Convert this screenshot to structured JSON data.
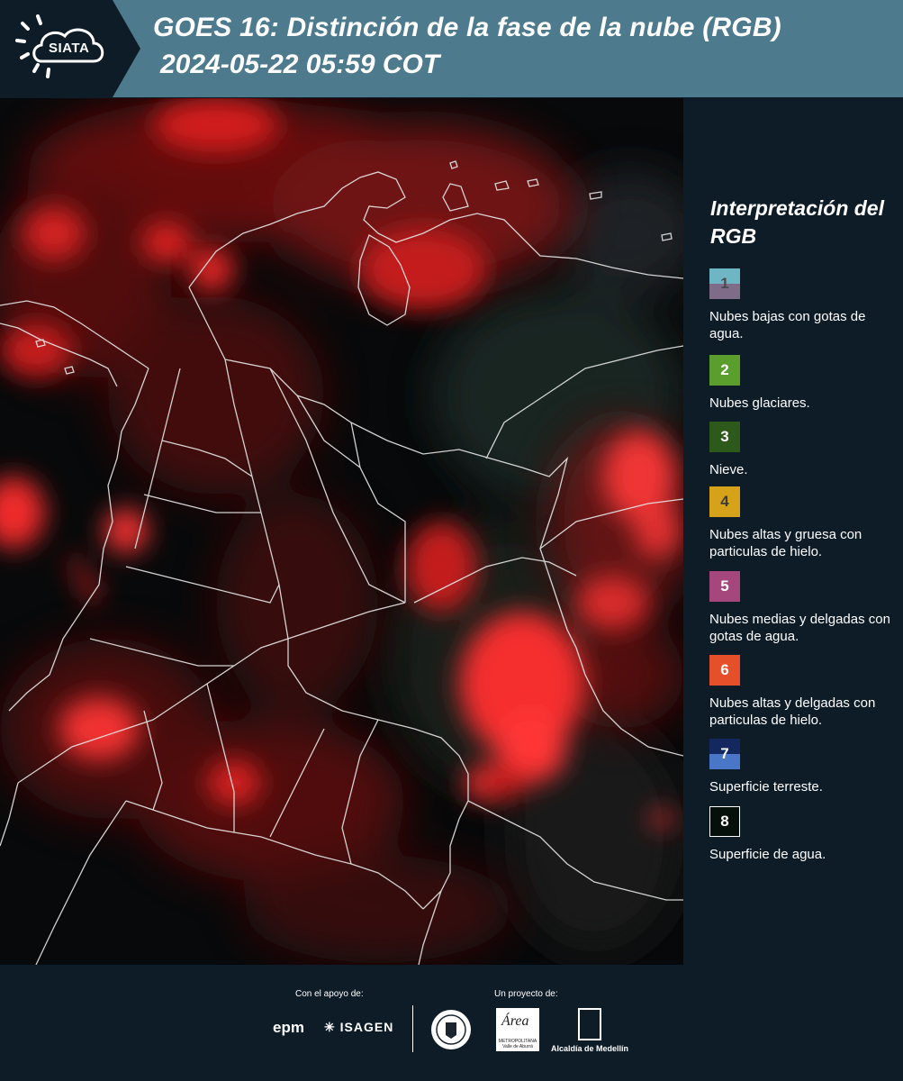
{
  "header": {
    "logo_text": "SIATA",
    "title": "GOES 16: Distinción de la fase de la nube (RGB)",
    "datetime": "2024-05-22 05:59 COT"
  },
  "legend": {
    "title": "Interpretación del RGB",
    "items": [
      {
        "number": "1",
        "colors": [
          "#6fb6c4",
          "#7f6c88"
        ],
        "description": "Nubes bajas con gotas de agua."
      },
      {
        "number": "2",
        "colors": [
          "#5c9e2e"
        ],
        "description": "Nubes glaciares."
      },
      {
        "number": "3",
        "colors": [
          "#2d5a1b"
        ],
        "description": "Nieve."
      },
      {
        "number": "4",
        "colors": [
          "#d6a21a"
        ],
        "description": "Nubes altas y gruesa con particulas de hielo."
      },
      {
        "number": "5",
        "colors": [
          "#a5477c"
        ],
        "description": "Nubes medias y delgadas con gotas de agua."
      },
      {
        "number": "6",
        "colors": [
          "#e5502a"
        ],
        "description": "Nubes altas y delgadas con particulas de hielo."
      },
      {
        "number": "7",
        "colors": [
          "#13285e",
          "#4a76c7"
        ],
        "description": "Superficie terreste."
      },
      {
        "number": "8",
        "colors": [
          "#05100a"
        ],
        "description": "Superficie de agua."
      }
    ]
  },
  "footer": {
    "support_label": "Con el apoyo de:",
    "project_label": "Un proyecto de:",
    "sponsor_1": "epm",
    "sponsor_2": "ISAGEN",
    "partner_1": "Área",
    "partner_1_sub": "METROPOLITANA Valle de Aburrá",
    "partner_2": "Alcaldía de Medellín"
  }
}
